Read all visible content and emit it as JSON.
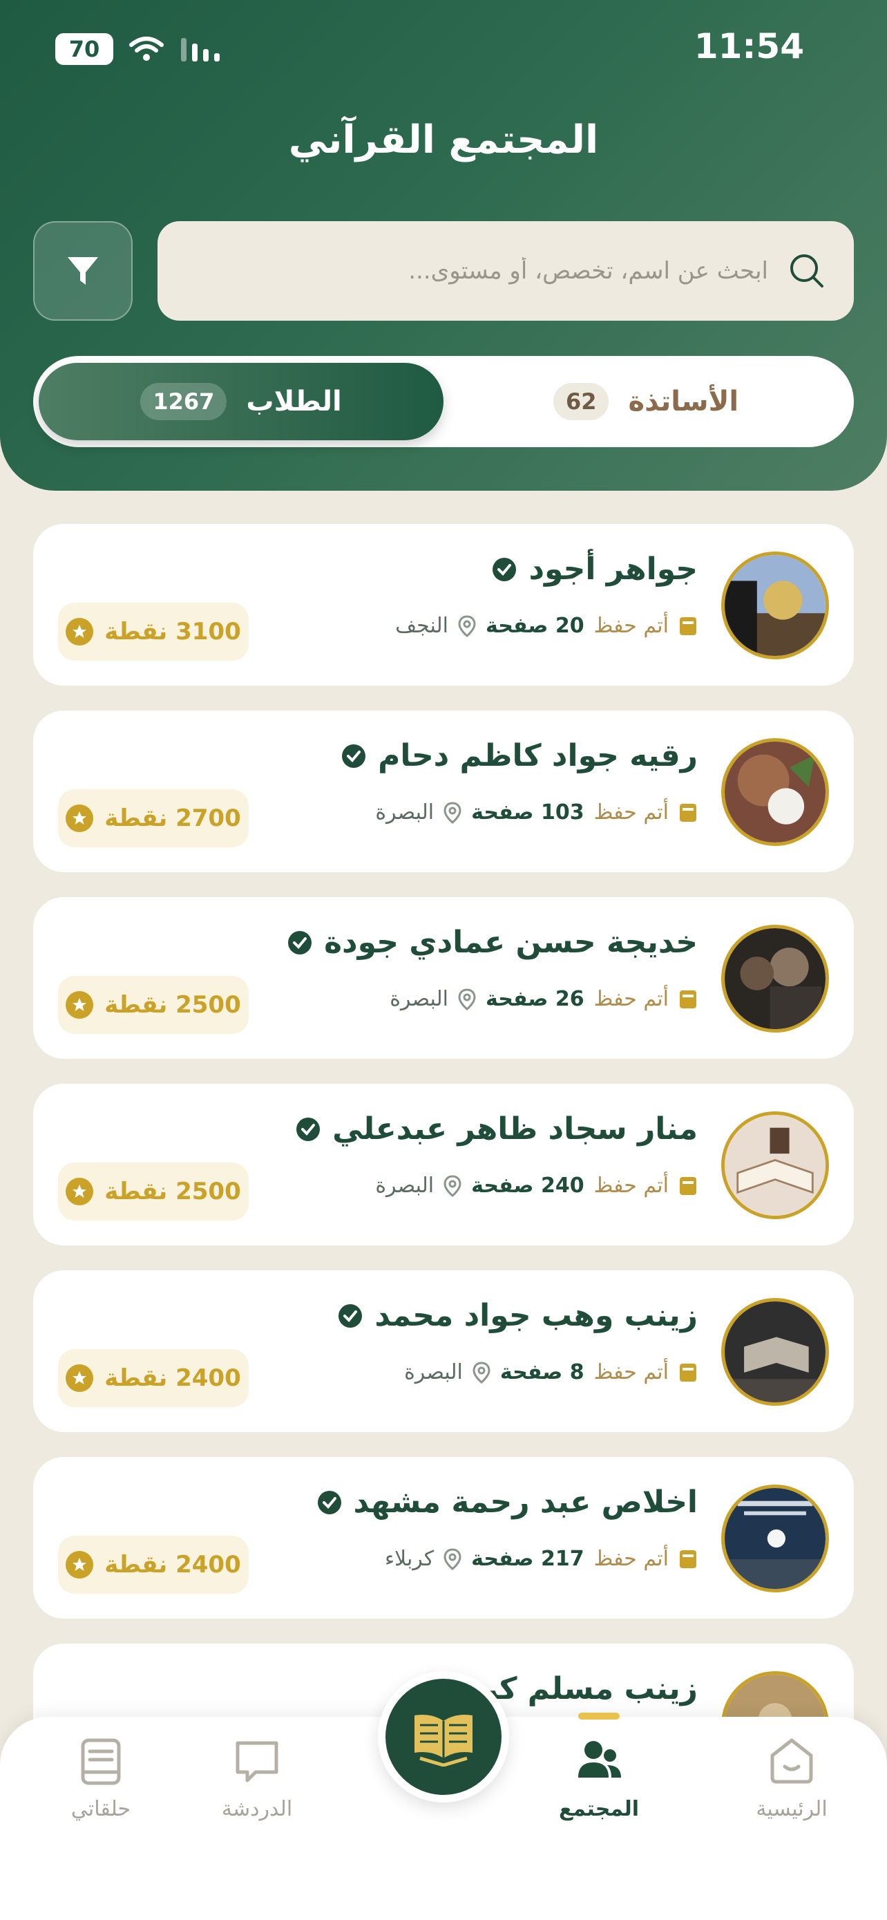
{
  "status_bar": {
    "time": "11:54",
    "battery": "70"
  },
  "header": {
    "title": "المجتمع القرآني",
    "search_placeholder": "ابحث عن اسم، تخصص، أو مستوى..."
  },
  "tabs": [
    {
      "label": "الأساتذة",
      "count": "62",
      "active": false
    },
    {
      "label": "الطلاب",
      "count": "1267",
      "active": true
    }
  ],
  "students": [
    {
      "name": "جواهر أجود",
      "memorized_label": "أتم حفظ",
      "pages": "20 صفحة",
      "city": "النجف",
      "points": "3100 نقطة"
    },
    {
      "name": "رقيه جواد كاظم دحام",
      "memorized_label": "أتم حفظ",
      "pages": "103 صفحة",
      "city": "البصرة",
      "points": "2700 نقطة"
    },
    {
      "name": "خديجة حسن عمادي جودة",
      "memorized_label": "أتم حفظ",
      "pages": "26 صفحة",
      "city": "البصرة",
      "points": "2500 نقطة"
    },
    {
      "name": "منار سجاد ظاهر عبدعلي",
      "memorized_label": "أتم حفظ",
      "pages": "240 صفحة",
      "city": "البصرة",
      "points": "2500 نقطة"
    },
    {
      "name": "زينب وهب جواد محمد",
      "memorized_label": "أتم حفظ",
      "pages": "8 صفحة",
      "city": "البصرة",
      "points": "2400 نقطة"
    },
    {
      "name": "اخلاص عبد رحمة مشهد",
      "memorized_label": "أتم حفظ",
      "pages": "217 صفحة",
      "city": "كربلاء",
      "points": "2400 نقطة"
    },
    {
      "name": "زينب مسلم كريم"
    }
  ],
  "bottom_nav": [
    {
      "label": "الرئيسية",
      "icon": "home-icon"
    },
    {
      "label": "المجتمع",
      "icon": "community-icon",
      "active": true
    },
    {
      "label": "الدردشة",
      "icon": "chat-icon"
    },
    {
      "label": "حلقاتي",
      "icon": "book-icon"
    }
  ],
  "colors": {
    "primary": "#1f4d3a",
    "accent": "#c9a227",
    "background": "#efeae0"
  }
}
